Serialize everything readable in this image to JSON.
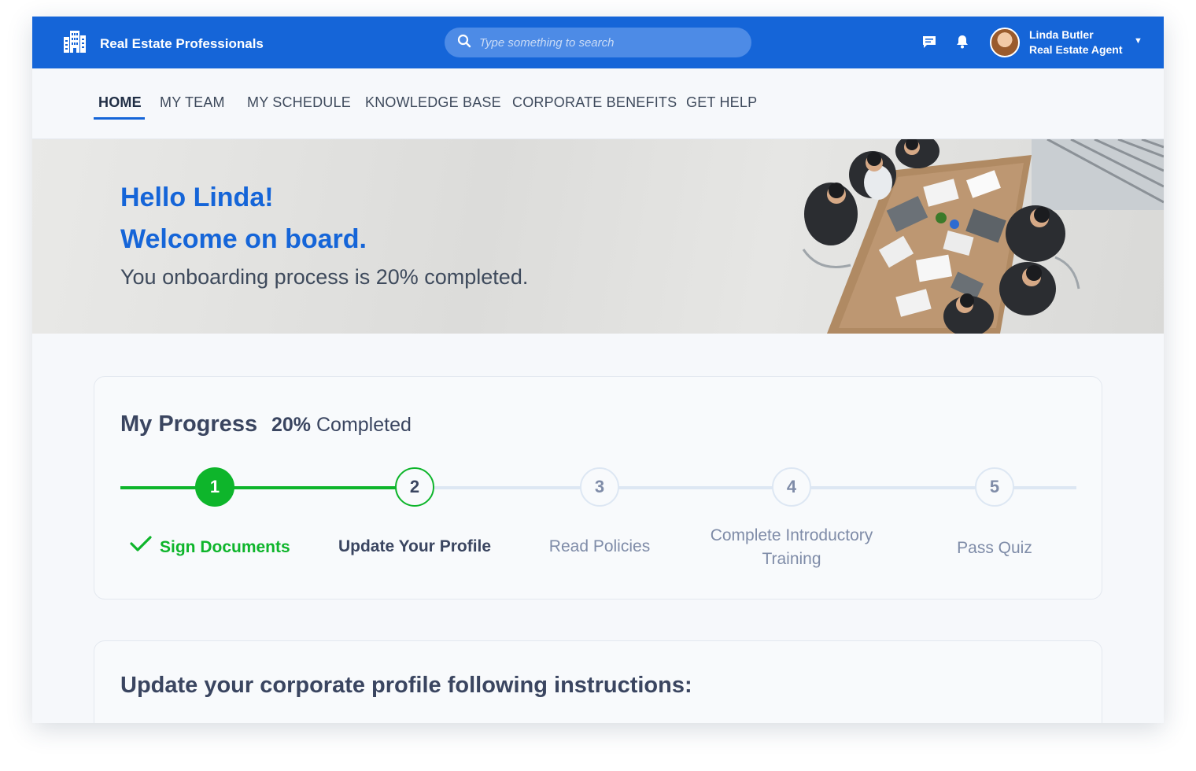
{
  "header": {
    "brand": "Real Estate Professionals",
    "search_placeholder": "Type something to search",
    "user_name": "Linda Butler",
    "user_role": "Real Estate Agent"
  },
  "nav": {
    "items": [
      {
        "label": "HOME",
        "active": true
      },
      {
        "label": "MY TEAM",
        "active": false
      },
      {
        "label": "MY SCHEDULE",
        "active": false
      },
      {
        "label": "KNOWLEDGE BASE",
        "active": false
      },
      {
        "label": "CORPORATE BENEFITS",
        "active": false
      },
      {
        "label": "GET HELP",
        "active": false
      }
    ]
  },
  "hero": {
    "greeting": "Hello Linda!",
    "welcome": "Welcome on board.",
    "status": "You onboarding process is 20% completed."
  },
  "progress": {
    "title": "My Progress",
    "percent": "20%",
    "completed_label": "Completed",
    "percent_value": 20,
    "steps": [
      {
        "number": "1",
        "label": "Sign Documents",
        "state": "done"
      },
      {
        "number": "2",
        "label": "Update Your Profile",
        "state": "current"
      },
      {
        "number": "3",
        "label": "Read Policies",
        "state": "todo"
      },
      {
        "number": "4",
        "label": "Complete Introductory Training",
        "state": "todo"
      },
      {
        "number": "5",
        "label": "Pass Quiz",
        "state": "todo"
      }
    ]
  },
  "profile_section": {
    "title": "Update your corporate profile following instructions:"
  },
  "colors": {
    "primary": "#1565d8",
    "success": "#0eb52b",
    "text_dark": "#3a4560",
    "muted": "#7f8ca8"
  },
  "icons": [
    "buildings-icon",
    "search-icon",
    "chat-icon",
    "bell-icon",
    "caret-down-icon",
    "check-icon"
  ]
}
